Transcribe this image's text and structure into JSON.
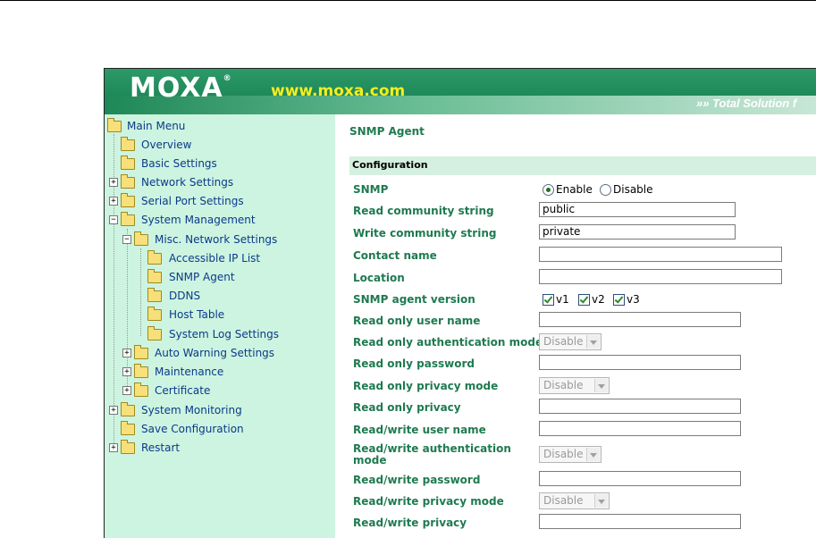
{
  "header": {
    "logo": "MOXA",
    "logo_mark": "®",
    "site": "www.moxa.com",
    "tagline": "»» Total Solution f"
  },
  "menu": {
    "items": [
      {
        "label": "Main Menu",
        "expander": ""
      },
      {
        "label": "Overview",
        "expander": ""
      },
      {
        "label": "Basic Settings",
        "expander": ""
      },
      {
        "label": "Network Settings",
        "expander": "+"
      },
      {
        "label": "Serial Port Settings",
        "expander": "+"
      },
      {
        "label": "System Management",
        "expander": "−"
      },
      {
        "label": "Misc. Network Settings",
        "expander": "−"
      },
      {
        "label": "Accessible IP List",
        "expander": ""
      },
      {
        "label": "SNMP Agent",
        "expander": ""
      },
      {
        "label": "DDNS",
        "expander": ""
      },
      {
        "label": "Host Table",
        "expander": ""
      },
      {
        "label": "System Log Settings",
        "expander": ""
      },
      {
        "label": "Auto Warning Settings",
        "expander": "+"
      },
      {
        "label": "Maintenance",
        "expander": "+"
      },
      {
        "label": "Certificate",
        "expander": "+"
      },
      {
        "label": "System Monitoring",
        "expander": "+"
      },
      {
        "label": "Save Configuration",
        "expander": ""
      },
      {
        "label": "Restart",
        "expander": "+"
      }
    ]
  },
  "page": {
    "title": "SNMP Agent",
    "section": "Configuration"
  },
  "form": {
    "snmp": {
      "label": "SNMP",
      "enable": "Enable",
      "disable": "Disable",
      "selected": "Enable"
    },
    "read_community": {
      "label": "Read community string",
      "value": "public"
    },
    "write_community": {
      "label": "Write community string",
      "value": "private"
    },
    "contact": {
      "label": "Contact name",
      "value": ""
    },
    "location": {
      "label": "Location",
      "value": ""
    },
    "version": {
      "label": "SNMP agent version",
      "v1": "v1",
      "v2": "v2",
      "v3": "v3",
      "checked": [
        "v1",
        "v2",
        "v3"
      ]
    },
    "ro_user": {
      "label": "Read only user name",
      "value": ""
    },
    "ro_auth": {
      "label": "Read only authentication mode",
      "value": "Disable"
    },
    "ro_pass": {
      "label": "Read only password",
      "value": ""
    },
    "ro_privmode": {
      "label": "Read only privacy mode",
      "value": "Disable"
    },
    "ro_priv": {
      "label": "Read only privacy",
      "value": ""
    },
    "rw_user": {
      "label": "Read/write user name",
      "value": ""
    },
    "rw_auth": {
      "label_line1": "Read/write authentication",
      "label_line2": "mode",
      "value": "Disable"
    },
    "rw_pass": {
      "label": "Read/write password",
      "value": ""
    },
    "rw_privmode": {
      "label": "Read/write privacy mode",
      "value": "Disable"
    },
    "rw_priv": {
      "label": "Read/write privacy",
      "value": ""
    }
  },
  "colors": {
    "banner_green": "#1f8a5a",
    "logo_yellow": "#f5ee20",
    "sidebar_bg": "#cdf4e0",
    "label_green": "#1f7a50",
    "menu_link": "#0b3a8a"
  }
}
